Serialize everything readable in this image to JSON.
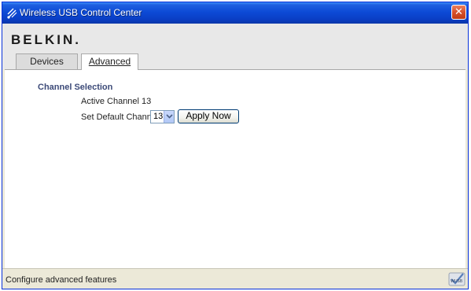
{
  "window": {
    "title": "Wireless USB Control Center",
    "close_label": "✕"
  },
  "header": {
    "logo_text": "BELKIN."
  },
  "tabs": [
    {
      "label": "Devices",
      "selected": false
    },
    {
      "label": "Advanced",
      "selected": true
    }
  ],
  "advanced": {
    "section_title": "Channel Selection",
    "active_channel_text": "Active Channel 13",
    "default_channel_label": "Set Default Channel",
    "default_channel_value": "13",
    "apply_button_label": "Apply Now"
  },
  "statusbar": {
    "text": "Configure advanced features",
    "icon": "wusb-checkmark-icon"
  },
  "colors": {
    "titlebar": "#0a3ec4",
    "section_title": "#3c4a78",
    "close_button": "#d6502c"
  }
}
